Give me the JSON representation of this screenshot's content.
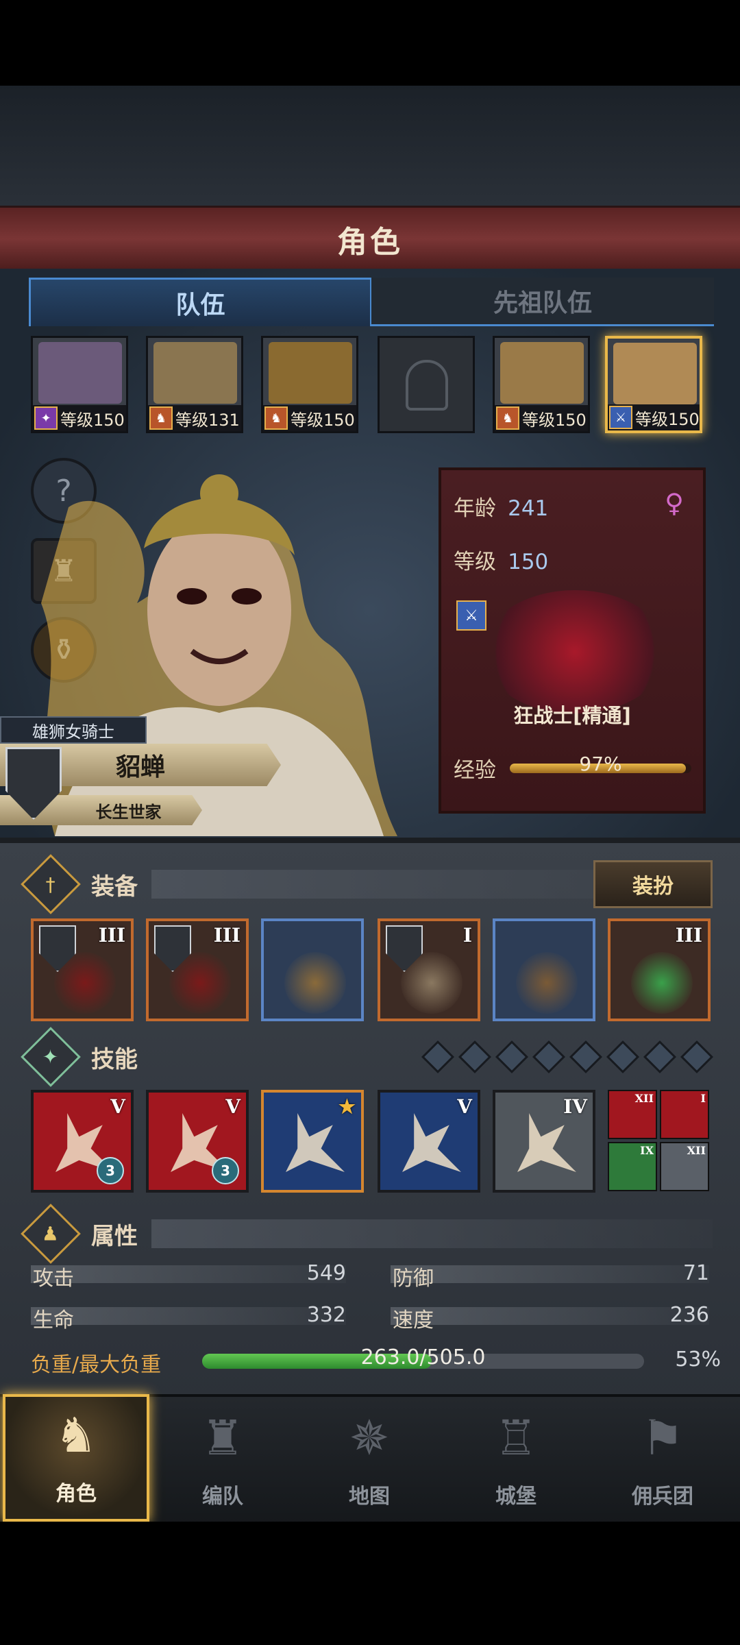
{
  "header": {
    "title": "角色"
  },
  "tabs": [
    {
      "label": "队伍",
      "active": true
    },
    {
      "label": "先祖队伍",
      "active": false
    }
  ],
  "roster": [
    {
      "level_text": "等级150",
      "badge_icon": "staff-icon",
      "badge": "✦",
      "selected": false,
      "portrait_color": "#6b5a7a"
    },
    {
      "level_text": "等级131",
      "badge_icon": "horse-icon",
      "badge": "♞",
      "selected": false,
      "portrait_color": "#8a7550"
    },
    {
      "level_text": "等级150",
      "badge_icon": "horse-icon",
      "badge": "♞",
      "selected": false,
      "portrait_color": "#8a6a30"
    },
    {
      "level_text": "",
      "badge_icon": "",
      "badge": "",
      "selected": false,
      "empty": true
    },
    {
      "level_text": "等级150",
      "badge_icon": "horse-icon",
      "badge": "♞",
      "selected": false,
      "portrait_color": "#9a7a48"
    },
    {
      "level_text": "等级150",
      "badge_icon": "sword-icon",
      "badge": "⚔",
      "selected": true,
      "portrait_color": "#b08a55"
    }
  ],
  "side_buttons": [
    {
      "icon": "question-icon",
      "glyph": "?"
    },
    {
      "icon": "armor-icon",
      "glyph": "♜"
    },
    {
      "icon": "potion-icon",
      "glyph": "⚱"
    }
  ],
  "character": {
    "class_title": "雄狮女骑士",
    "name": "貂蝉",
    "house": "长生世家",
    "age_label": "年龄",
    "age": "241",
    "level_label": "等级",
    "level": "150",
    "gender_symbol": "♀",
    "class_name": "狂战士[精通]",
    "exp_label": "经验",
    "exp_text": "97%",
    "exp_fraction": 0.97
  },
  "equipment": {
    "title": "装备",
    "dress_button": "装扮",
    "items": [
      {
        "rank": "III",
        "style": "orange",
        "shield": true,
        "color": "#7a1a1a"
      },
      {
        "rank": "III",
        "style": "orange",
        "shield": true,
        "color": "#7a1a1a"
      },
      {
        "rank": "",
        "style": "blue",
        "shield": false,
        "color": "#8a6a3a"
      },
      {
        "rank": "I",
        "style": "orange",
        "shield": true,
        "color": "#8a7860"
      },
      {
        "rank": "",
        "style": "blue",
        "shield": false,
        "color": "#7a5a36"
      },
      {
        "rank": "III",
        "style": "orange",
        "shield": false,
        "color": "#3aa04a"
      }
    ]
  },
  "skills": {
    "title": "技能",
    "gem_count": 8,
    "items": [
      {
        "rank": "V",
        "bg": "red",
        "chip": "3",
        "border": ""
      },
      {
        "rank": "V",
        "bg": "red",
        "chip": "3",
        "border": ""
      },
      {
        "rank": "★",
        "bg": "blue",
        "chip": "",
        "border": "orange"
      },
      {
        "rank": "V",
        "bg": "blue",
        "chip": "",
        "border": ""
      },
      {
        "rank": "IV",
        "bg": "gray",
        "chip": "",
        "border": ""
      }
    ],
    "mini": [
      {
        "rank": "XII",
        "bg": "#a1171f"
      },
      {
        "rank": "I",
        "bg": "#a1171f"
      },
      {
        "rank": "IX",
        "bg": "#2e7a3a"
      },
      {
        "rank": "XII",
        "bg": "#5a6068"
      }
    ]
  },
  "attributes": {
    "title": "属性",
    "attack_label": "攻击",
    "attack": "549",
    "defense_label": "防御",
    "defense": "71",
    "hp_label": "生命",
    "hp": "332",
    "speed_label": "速度",
    "speed": "236",
    "load_label": "负重/最大负重",
    "load_text": "263.0/505.0",
    "load_percent": "53%",
    "load_fraction": 0.52
  },
  "nav": [
    {
      "label": "角色",
      "icon": "knight-icon",
      "glyph": "♞",
      "active": true
    },
    {
      "label": "编队",
      "icon": "helmet-icon",
      "glyph": "♜",
      "active": false
    },
    {
      "label": "地图",
      "icon": "compass-icon",
      "glyph": "✵",
      "active": false
    },
    {
      "label": "城堡",
      "icon": "castle-icon",
      "glyph": "♖",
      "active": false
    },
    {
      "label": "佣兵团",
      "icon": "banner-icon",
      "glyph": "⚑",
      "active": false
    }
  ]
}
